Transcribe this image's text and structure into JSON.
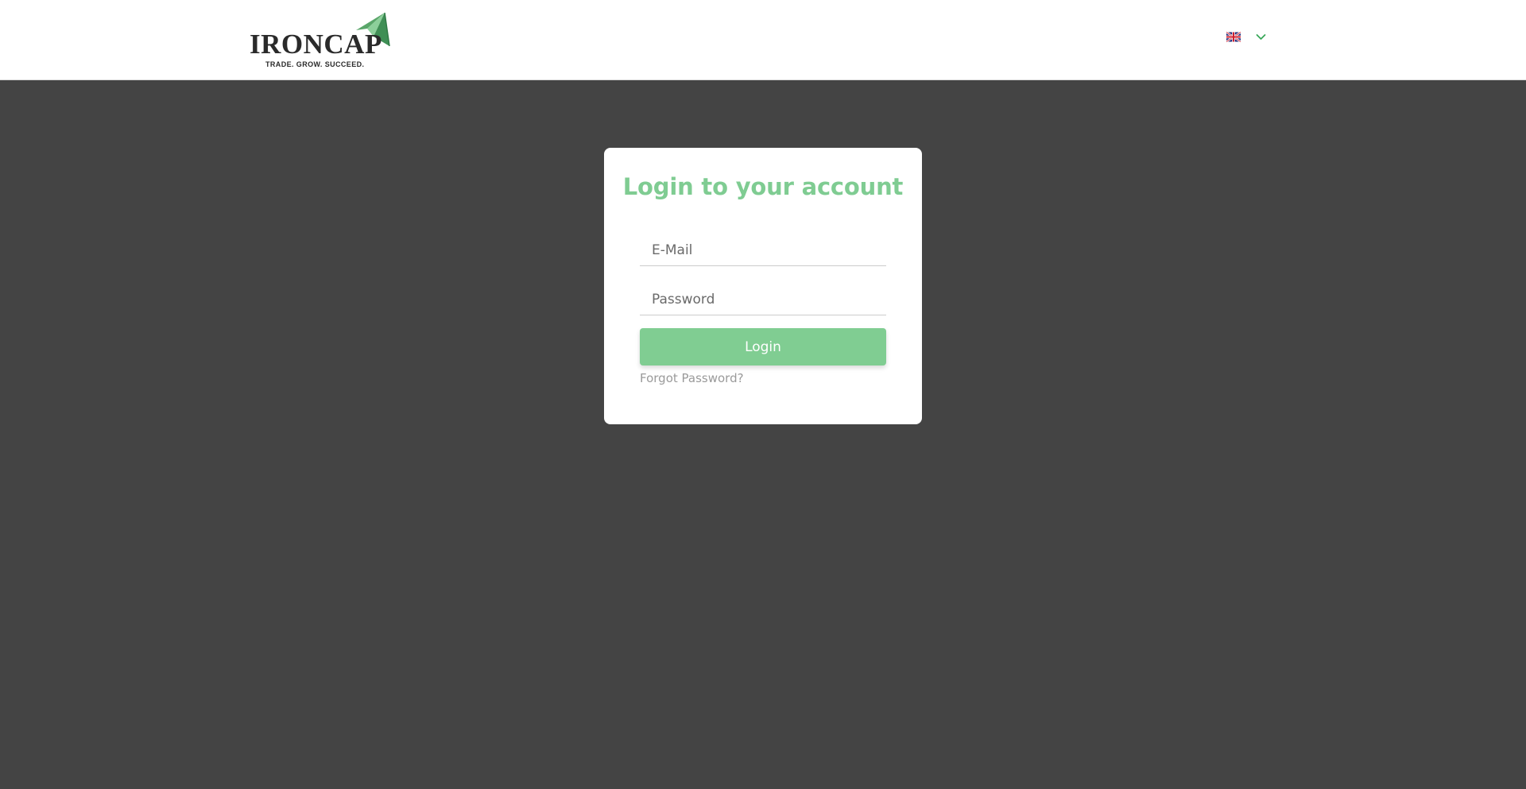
{
  "header": {
    "logo": {
      "wordmark": "IRONCAP",
      "tagline": "TRADE. GROW. SUCCEED.",
      "mark_icon": "paper-plane-icon",
      "mark_color": "#5aa66a"
    },
    "language": {
      "flag_icon": "uk-flag-icon",
      "dropdown_icon": "chevron-down-icon",
      "chevron_color": "#3aa85a"
    }
  },
  "login": {
    "title": "Login to your account",
    "email_placeholder": "E-Mail",
    "email_value": "",
    "password_placeholder": "Password",
    "password_value": "",
    "login_label": "Login",
    "forgot_label": "Forgot Password?"
  },
  "colors": {
    "page_background": "#444444",
    "header_background": "#ffffff",
    "accent": "#80cd92",
    "card_background": "#ffffff",
    "link_text": "#9a9a9a"
  }
}
